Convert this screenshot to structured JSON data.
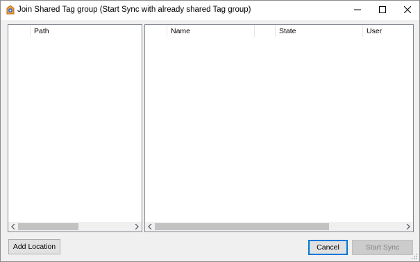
{
  "window": {
    "title": "Join Shared Tag group (Start Sync with already shared Tag group)"
  },
  "left_pane": {
    "columns": [
      "",
      "Path"
    ]
  },
  "right_pane": {
    "columns": [
      "",
      "Name",
      "",
      "State",
      "User"
    ]
  },
  "buttons": {
    "add_location": "Add Location",
    "cancel": "Cancel",
    "start_sync": "Start Sync"
  },
  "colors": {
    "focus_border": "#0078d7",
    "disabled_text": "#838383"
  }
}
